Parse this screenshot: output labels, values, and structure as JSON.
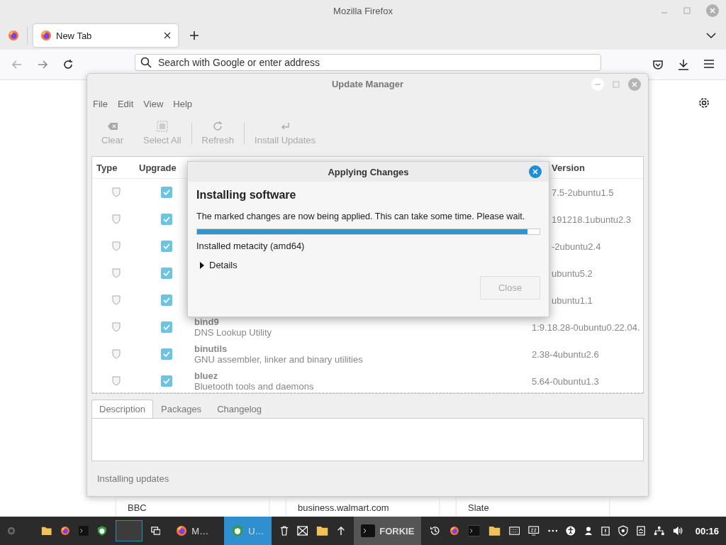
{
  "firefox": {
    "title": "Mozilla Firefox",
    "tabs": [
      {
        "label": "New Tab",
        "selected": true
      }
    ],
    "address": {
      "placeholder": "Search with Google or enter address"
    },
    "shortcuts": [
      "BBC",
      "business.walmart.com",
      "Slate"
    ]
  },
  "update_manager": {
    "title": "Update Manager",
    "menu": [
      "File",
      "Edit",
      "View",
      "Help"
    ],
    "toolbar": [
      {
        "label": "Clear",
        "kind": "clear",
        "disabled": true
      },
      {
        "label": "Select All",
        "kind": "select",
        "disabled": true
      },
      {
        "label": "Refresh",
        "kind": "refresh",
        "disabled": true
      },
      {
        "label": "Install Updates",
        "kind": "install",
        "disabled": true
      }
    ],
    "columns": [
      "Type",
      "Upgrade",
      "Version"
    ],
    "rows": [
      {
        "checked": true,
        "version": "7.5-2ubuntu1.5"
      },
      {
        "checked": true,
        "version": "191218.1ubuntu2.3"
      },
      {
        "checked": true,
        "version": "-2ubuntu2.4"
      },
      {
        "checked": true,
        "version": "ubuntu5.2"
      },
      {
        "checked": true,
        "version": "ubuntu1.1"
      },
      {
        "name": "bind9",
        "description": "DNS Lookup Utility",
        "checked": true,
        "version": "1:9.18.28-0ubuntu0.22.04."
      },
      {
        "name": "binutils",
        "description": "GNU assembler, linker and binary utilities",
        "checked": true,
        "version": "2.38-4ubuntu2.6"
      },
      {
        "name": "bluez",
        "description": "Bluetooth tools and daemons",
        "checked": true,
        "version": "5.64-0ubuntu1.3"
      }
    ],
    "detail_tabs": [
      {
        "label": "Description",
        "selected": true
      },
      {
        "label": "Packages",
        "selected": false
      },
      {
        "label": "Changelog",
        "selected": false
      }
    ],
    "status": "Installing updates"
  },
  "dialog": {
    "title": "Applying Changes",
    "heading": "Installing software",
    "message": "The marked changes are now being applied. This can take some time. Please wait.",
    "progress": {
      "level": 0.965
    },
    "current": "Installed metacity (amd64)",
    "details": {
      "label": "Details",
      "expanded": false
    },
    "close_button": {
      "label": "Close",
      "disabled": true
    }
  },
  "taskbar": {
    "tasks": [
      {
        "label": "M…",
        "kind": "firefox",
        "selected": false
      },
      {
        "label": "U…",
        "kind": "shield",
        "selected": true
      },
      {
        "label": "FORKIE",
        "kind": "terminal",
        "selected": false
      }
    ],
    "clock": "00:16"
  }
}
